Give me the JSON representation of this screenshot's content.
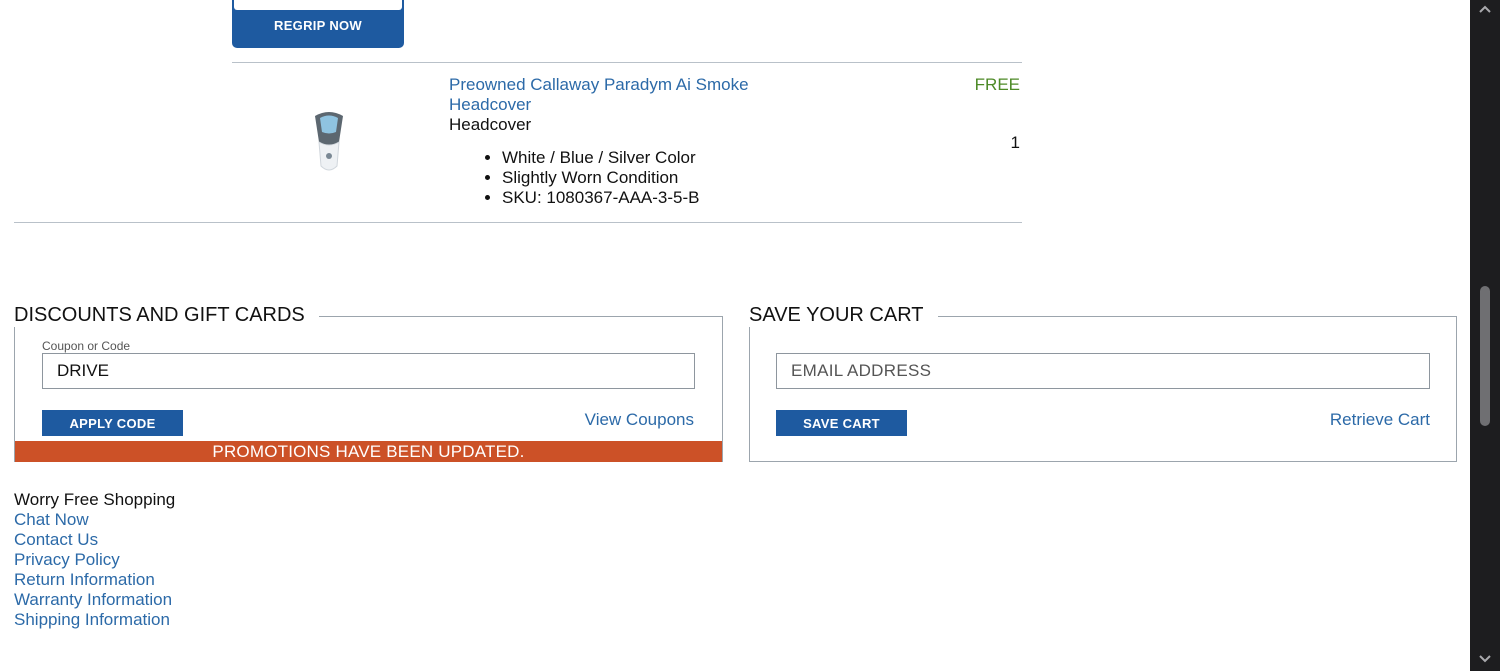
{
  "regrip": {
    "button_label": "REGRIP NOW"
  },
  "product": {
    "title": "Preowned Callaway Paradym Ai Smoke Headcover",
    "type": "Headcover",
    "attributes": [
      "White / Blue / Silver Color",
      "Slightly Worn Condition",
      "SKU: 1080367-AAA-3-5-B"
    ],
    "price": "FREE",
    "quantity": "1"
  },
  "discounts": {
    "title": "DISCOUNTS AND GIFT CARDS",
    "coupon_label": "Coupon or Code",
    "coupon_value": "DRIVE",
    "apply_label": "APPLY CODE",
    "view_coupons_label": "View Coupons",
    "promo_message": "PROMOTIONS HAVE BEEN UPDATED."
  },
  "save_cart": {
    "title": "SAVE YOUR CART",
    "email_placeholder": "EMAIL ADDRESS",
    "save_label": "SAVE CART",
    "retrieve_label": "Retrieve Cart"
  },
  "footer": {
    "heading": "Worry Free Shopping",
    "links": [
      "Chat Now",
      "Contact Us",
      "Privacy Policy",
      "Return Information",
      "Warranty Information",
      "Shipping Information"
    ]
  },
  "colors": {
    "primary_blue": "#1e5aa0",
    "link_blue": "#2c6aa8",
    "free_green": "#4d8a27",
    "promo_orange": "#cc5127"
  }
}
